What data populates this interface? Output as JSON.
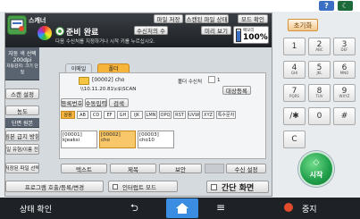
{
  "top": {
    "help": "?",
    "moon": "☾"
  },
  "app": {
    "title": "스캐너",
    "status": "준비 완료",
    "status_sub": "다음 수신처를 지정하거나 시작 키를 누르십시오.",
    "file_save": "파일 저장",
    "scanned_file_state": "스캔된 파일 상태",
    "mode_check": "모드 확인",
    "recipient_count_label": "수신처의 수",
    "preview_label": "미리 보기",
    "memory_label": "메모리",
    "memory_value": "100%",
    "side": {
      "auto_color": "자동 색 선택",
      "dpi": "200dpi",
      "auto_size": "자동감지: 크기 단일",
      "scan_settings": "스캔 설정",
      "density": "농도",
      "original_side": "단면 원본",
      "original_orient": "원본 급지 방향",
      "file_type": "파일 유형/이름 전송"
    },
    "tab_email": "이메일",
    "tab_folder": "폴더",
    "folder_id": "[00002]",
    "folder_name": "cho",
    "folder_path": "\\\\10.11.20.81\\c$\\SCAN",
    "folder_recipients_label": "폴더 수신처",
    "folder_recipients_value": "1",
    "register_target": "대상등록",
    "btn_number": "등록번호",
    "btn_manual": "수동입력",
    "btn_search": "검색",
    "alpha": [
      "상용",
      "AB",
      "CD",
      "EF",
      "GH",
      "IJK",
      "LMN",
      "OPQ",
      "RST",
      "UVW",
      "XYZ",
      "특수문자"
    ],
    "files": [
      {
        "id": "[00001]",
        "name": "kjeaksi"
      },
      {
        "id": "[00002]",
        "name": "cho"
      },
      {
        "id": "[00003]",
        "name": "cho10"
      }
    ],
    "save_file_select": "저장된 파일 선택",
    "text": "텍스트",
    "subject": "제목",
    "security": "보안",
    "receive_setting": "수신 설정",
    "program_label": "프로그램 호출/등록/변경",
    "interrupt_mode": "인터럽트 모드",
    "simple_screen": "간단 화면"
  },
  "right": {
    "reset": "초기화",
    "keys": [
      {
        "n": "1",
        "s": ""
      },
      {
        "n": "2",
        "s": "ABC"
      },
      {
        "n": "3",
        "s": "DEF"
      },
      {
        "n": "4",
        "s": "GHI"
      },
      {
        "n": "5",
        "s": "JKL"
      },
      {
        "n": "6",
        "s": "MNO"
      },
      {
        "n": "7",
        "s": "PQRS"
      },
      {
        "n": "8",
        "s": "TUV"
      },
      {
        "n": "9",
        "s": "WXYZ"
      },
      {
        "n": "/✱",
        "s": ""
      },
      {
        "n": "0",
        "s": ""
      },
      {
        "n": "#",
        "s": ""
      }
    ],
    "clear": "C",
    "start": "시작",
    "start_icon": "◇"
  },
  "bottom": {
    "status_check": "상태 확인",
    "stop": "중지"
  }
}
